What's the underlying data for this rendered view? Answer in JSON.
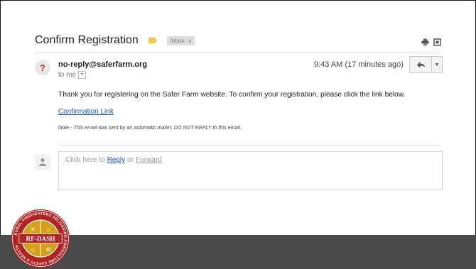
{
  "email": {
    "subject": "Confirm Registration",
    "label_chip": "Inbox",
    "label_chip_close": "x",
    "sender": "no-reply@saferfarm.org",
    "to_line": "to me",
    "time": "9:43 AM (17 minutes ago)",
    "body": "Thank you for registering on the Safer Farm website. To confirm your registration, please click the link below.",
    "link_text": "Confirmation Link",
    "note": "Note - This email was sent by an automatic mailer. DO NOT REPLY to this email."
  },
  "reply_box": {
    "prefix": "Click here to",
    "reply": "Reply",
    "or": "or",
    "forward": "Forward"
  },
  "logo": {
    "center_text": "RF-DASH",
    "ring_text": "RURAL FIREFIGHTERS DELIVERING AGRICULTURE SAFETY & HEALTH"
  },
  "colors": {
    "label_yellow": "#f2c94c",
    "link_blue": "#1a56cc",
    "logo_red": "#b22222",
    "logo_gold": "#d4a017",
    "footer_gray": "#4a4a4a"
  },
  "icons": [
    "print-icon",
    "new-window-icon",
    "unknown-sender-icon",
    "star-icon",
    "reply-arrow-icon",
    "dropdown-icon",
    "person-icon"
  ]
}
